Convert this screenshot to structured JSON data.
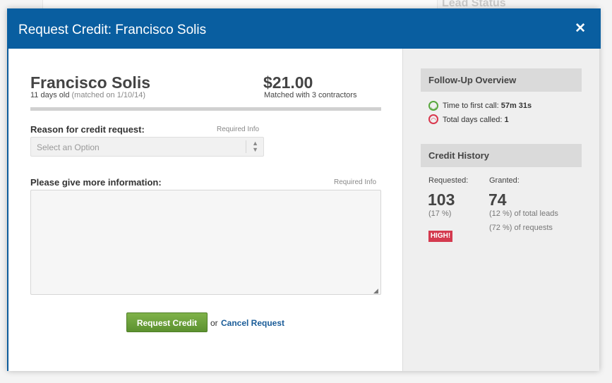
{
  "background": {
    "lead_status": "Lead Status"
  },
  "modal": {
    "title": "Request Credit: Francisco Solis",
    "close_icon": "close-icon"
  },
  "lead": {
    "name": "Francisco Solis",
    "age": "11 days old",
    "matched_on": "(matched on 1/10/14)",
    "price": "$21.00",
    "matched_with": "Matched with 3 contractors"
  },
  "form": {
    "reason_label": "Reason for credit request:",
    "reason_required": "Required Info",
    "reason_placeholder": "Select an Option",
    "info_label": "Please give more information:",
    "info_required": "Required Info",
    "info_value": "",
    "submit_label": "Request Credit",
    "or_text": "or",
    "cancel_label": "Cancel Request"
  },
  "follow_up": {
    "heading": "Follow-Up Overview",
    "first_call_label": "Time to first call:",
    "first_call_value": "57m 31s",
    "days_called_label": "Total days called:",
    "days_called_value": "1",
    "icons": [
      "smile-icon",
      "frown-icon"
    ],
    "colors": {
      "good": "#58a73e",
      "bad": "#d9374d"
    }
  },
  "credit_history": {
    "heading": "Credit History",
    "requested_label": "Requested:",
    "requested_value": "103",
    "requested_pct": "(17 %)",
    "badge": "HIGH!",
    "granted_label": "Granted:",
    "granted_value": "74",
    "granted_pct_total": "(12 %) of total leads",
    "granted_pct_requests": "(72 %) of requests"
  },
  "colors": {
    "header": "#095ea0",
    "button": "#6aa23b",
    "link": "#1a5c98",
    "badge": "#d43a4f"
  }
}
